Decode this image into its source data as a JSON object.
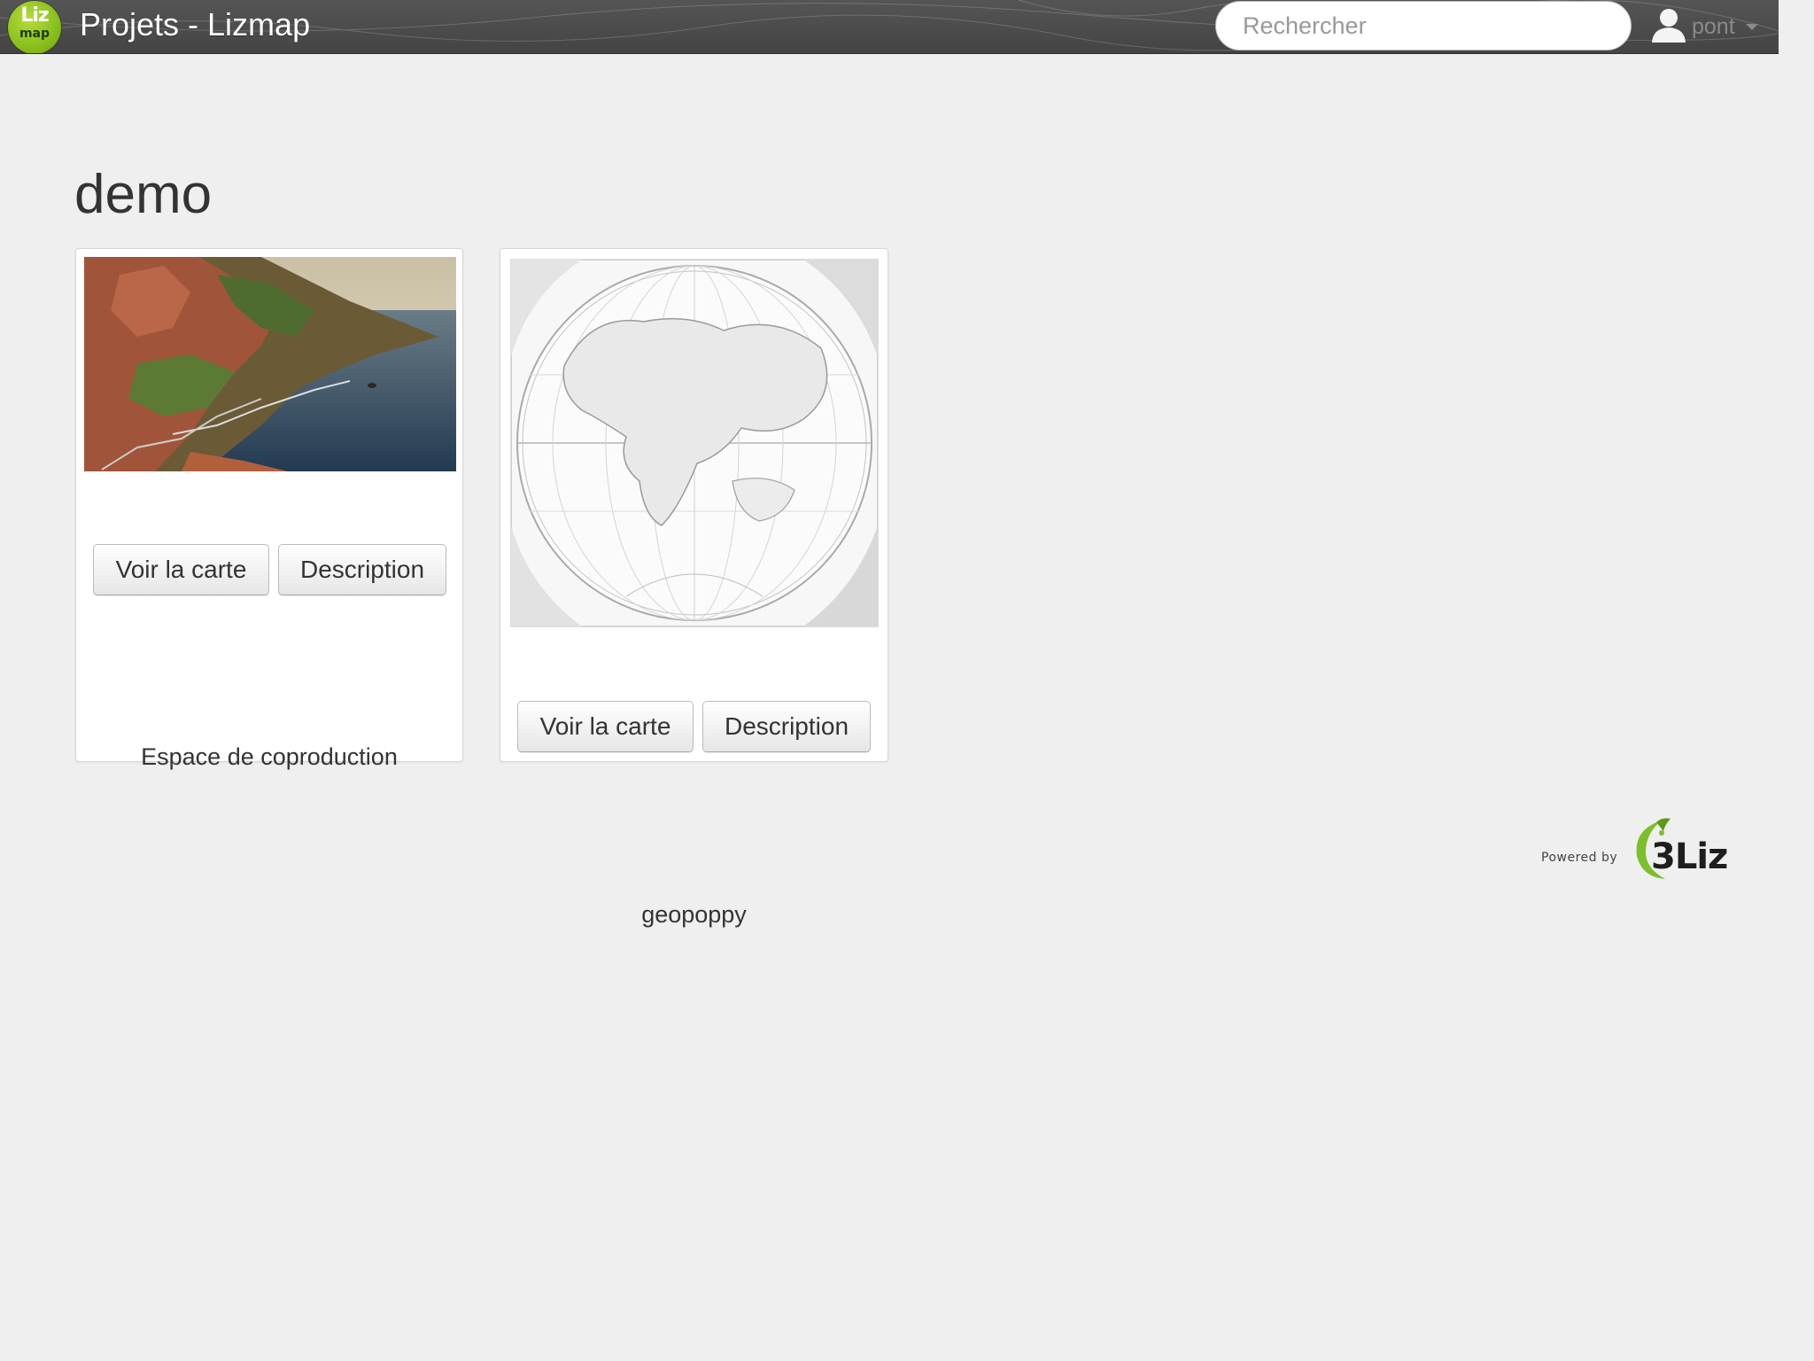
{
  "header": {
    "logo_top": "Liz",
    "logo_bottom": "map",
    "title": "Projets - Lizmap",
    "search_placeholder": "Rechercher",
    "user_name": "pont",
    "user_icon": "user-icon",
    "menu_icon": "caret-down-icon"
  },
  "section": {
    "title": "demo",
    "projects": [
      {
        "name": "Espace de coproduction",
        "thumbnail": "coastal-landscape-photo",
        "view_map_label": "Voir la carte",
        "description_label": "Description"
      },
      {
        "name": "geopoppy",
        "thumbnail": "antique-world-map",
        "view_map_label": "Voir la carte",
        "description_label": "Description"
      }
    ]
  },
  "footer": {
    "powered_label": "Powered by",
    "brand": "3Liz",
    "brand_color": "#7cbf2a"
  },
  "colors": {
    "header_bg": "#4a4a4a",
    "page_bg": "#efefef",
    "logo_green": "#8cc21d"
  }
}
